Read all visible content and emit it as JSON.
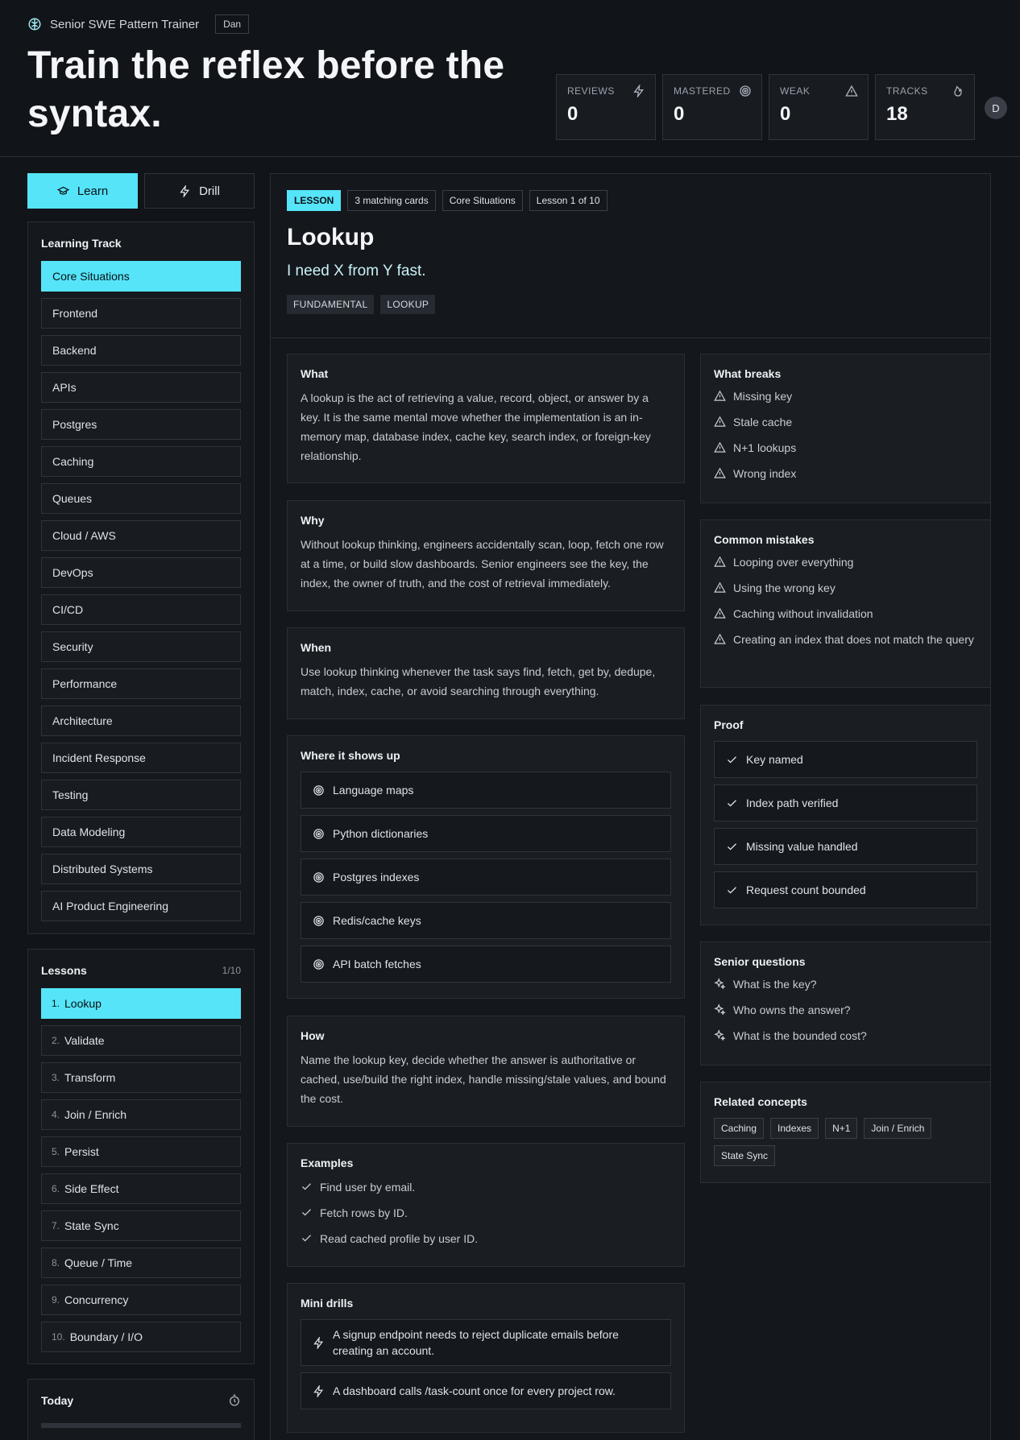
{
  "app": {
    "brand": "Senior SWE Pattern Trainer",
    "user": "Dan",
    "avatar_initial": "D"
  },
  "hero": {
    "line1": "Train the reflex before the",
    "line2": "syntax."
  },
  "stats": [
    {
      "label": "REVIEWS",
      "value": "0",
      "icon": "lightning-icon"
    },
    {
      "label": "MASTERED",
      "value": "0",
      "icon": "target-icon"
    },
    {
      "label": "WEAK",
      "value": "0",
      "icon": "warning-icon"
    },
    {
      "label": "TRACKS",
      "value": "18",
      "icon": "flame-icon"
    }
  ],
  "modes": {
    "learn": "Learn",
    "drill": "Drill"
  },
  "track": {
    "title": "Learning Track",
    "items": [
      "Core Situations",
      "Frontend",
      "Backend",
      "APIs",
      "Postgres",
      "Caching",
      "Queues",
      "Cloud / AWS",
      "DevOps",
      "CI/CD",
      "Security",
      "Performance",
      "Architecture",
      "Incident Response",
      "Testing",
      "Data Modeling",
      "Distributed Systems",
      "AI Product Engineering"
    ]
  },
  "lessons": {
    "title": "Lessons",
    "count": "1/10",
    "items": [
      {
        "num": "1.",
        "label": "Lookup"
      },
      {
        "num": "2.",
        "label": "Validate"
      },
      {
        "num": "3.",
        "label": "Transform"
      },
      {
        "num": "4.",
        "label": "Join / Enrich"
      },
      {
        "num": "5.",
        "label": "Persist"
      },
      {
        "num": "6.",
        "label": "Side Effect"
      },
      {
        "num": "7.",
        "label": "State Sync"
      },
      {
        "num": "8.",
        "label": "Queue / Time"
      },
      {
        "num": "9.",
        "label": "Concurrency"
      },
      {
        "num": "10.",
        "label": "Boundary / I/O"
      }
    ]
  },
  "today": {
    "title": "Today"
  },
  "lesson": {
    "chips": [
      "LESSON",
      "3 matching cards",
      "Core Situations",
      "Lesson 1 of 10"
    ],
    "title": "Lookup",
    "subtitle": "I need X from Y fast.",
    "tags": [
      "FUNDAMENTAL",
      "LOOKUP"
    ],
    "what": {
      "title": "What",
      "body": "A lookup is the act of retrieving a value, record, object, or answer by a key. It is the same mental move whether the implementation is an in-memory map, database index, cache key, search index, or foreign-key relationship."
    },
    "why": {
      "title": "Why",
      "body": "Without lookup thinking, engineers accidentally scan, loop, fetch one row at a time, or build slow dashboards. Senior engineers see the key, the index, the owner of truth, and the cost of retrieval immediately."
    },
    "when": {
      "title": "When",
      "body": "Use lookup thinking whenever the task says find, fetch, get by, dedupe, match, index, cache, or avoid searching through everything."
    },
    "where": {
      "title": "Where it shows up",
      "items": [
        "Language maps",
        "Python dictionaries",
        "Postgres indexes",
        "Redis/cache keys",
        "API batch fetches"
      ]
    },
    "how": {
      "title": "How",
      "body": "Name the lookup key, decide whether the answer is authoritative or cached, use/build the right index, handle missing/stale values, and bound the cost."
    },
    "examples": {
      "title": "Examples",
      "items": [
        "Find user by email.",
        "Fetch rows by ID.",
        "Read cached profile by user ID."
      ]
    },
    "mini_drills": {
      "title": "Mini drills",
      "items": [
        "A signup endpoint needs to reject duplicate emails before creating an account.",
        "A dashboard calls /task-count once for every project row."
      ]
    },
    "breaks": {
      "title": "What breaks",
      "items": [
        "Missing key",
        "Stale cache",
        "N+1 lookups",
        "Wrong index"
      ]
    },
    "mistakes": {
      "title": "Common mistakes",
      "items": [
        "Looping over everything",
        "Using the wrong key",
        "Caching without invalidation",
        "Creating an index that does not match the query"
      ]
    },
    "proof": {
      "title": "Proof",
      "items": [
        "Key named",
        "Index path verified",
        "Missing value handled",
        "Request count bounded"
      ]
    },
    "questions": {
      "title": "Senior questions",
      "items": [
        "What is the key?",
        "Who owns the answer?",
        "What is the bounded cost?"
      ]
    },
    "related": {
      "title": "Related concepts",
      "items": [
        "Caching",
        "Indexes",
        "N+1",
        "Join / Enrich",
        "State Sync"
      ]
    }
  }
}
